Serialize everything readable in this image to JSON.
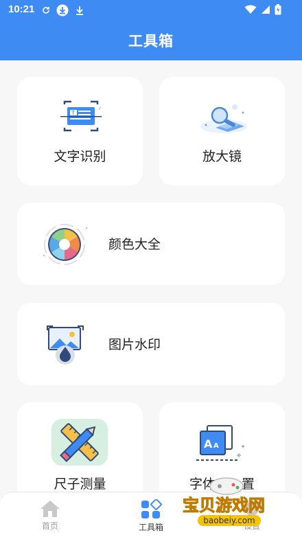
{
  "status_bar": {
    "time": "10:21",
    "icons_left": [
      "sync-icon",
      "download-badge-icon",
      "download-icon"
    ],
    "icons_right": [
      "wifi-icon",
      "signal-icon",
      "battery-icon"
    ]
  },
  "header": {
    "title": "工具箱",
    "background": "#3d8bf3"
  },
  "tools": {
    "text_recognition": {
      "label": "文字识别",
      "icon": "text-scan-icon"
    },
    "magnifier": {
      "label": "放大镜",
      "icon": "magnifier-icon"
    },
    "colors": {
      "label": "颜色大全",
      "icon": "color-wheel-icon"
    },
    "watermark": {
      "label": "图片水印",
      "icon": "image-watermark-icon"
    },
    "ruler": {
      "label": "尺子测量",
      "icon": "ruler-pencil-icon"
    },
    "font": {
      "label": "字体",
      "icon": "font-size-icon"
    },
    "font_suffix": "置"
  },
  "bottom_nav": {
    "items": [
      {
        "label": "首页",
        "icon": "home-icon"
      },
      {
        "label": "工具箱",
        "icon": "toolbox-icon"
      },
      {
        "label": "设置",
        "icon": "settings-icon"
      }
    ]
  },
  "overlay_watermark": {
    "name": "宝贝游戏网",
    "url": "baobeiy.com"
  }
}
